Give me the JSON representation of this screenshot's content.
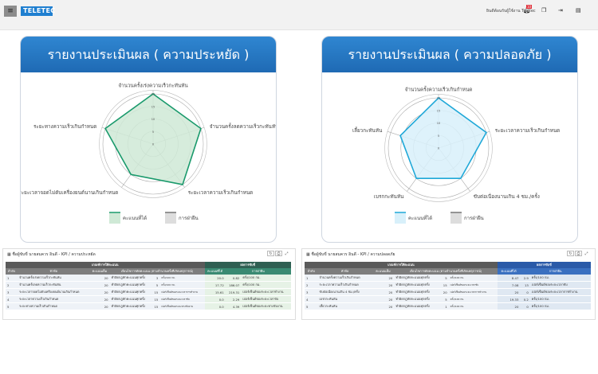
{
  "header": {
    "logo": "TELETEC",
    "welcome": "ยินดีต้อนรับผู้ใช้งาน Teletec",
    "notification_count": "10",
    "icons": [
      "menu-icon",
      "bell-icon",
      "copy-icon",
      "logout-icon",
      "settings-icon"
    ]
  },
  "colors": {
    "economy": "#1a9a6c",
    "economy_fill": "#cfe9d6",
    "safety": "#1fa8d8",
    "safety_fill": "#d8f0fa",
    "header_blue": "#2a7bc8"
  },
  "chart_data": [
    {
      "type": "radar",
      "title": "รายงานประเมินผล ( ความประหยัด )",
      "axes": [
        "จำนวนครั้งเร่งความเร็วกะทันหัน",
        "จำนวนครั้งลดความเร็วกะทันหัน",
        "ระยะเวลาความเร็วเกินกำหนด",
        "ระยะเวลาจอดไม่ดับเครื่องยนต์นานเกินกำหนด",
        "ระยะทางความเร็วเกินกำหนด"
      ],
      "ticks": [
        0,
        5,
        10,
        15,
        20
      ],
      "range": [
        0,
        20
      ],
      "series": [
        {
          "name": "คะแนนที่ได้",
          "values": [
            20,
            20,
            20,
            15,
            20
          ]
        },
        {
          "name": "การฝ่าฝืน",
          "values": []
        }
      ],
      "legend": "bottom"
    },
    {
      "type": "radar",
      "title": "รายงานประเมินผล ( ความปลอดภัย )",
      "axes": [
        "จำนวนครั้งความเร็วเกินกำหนด",
        "ระยะเวลาความเร็วเกินกำหนด",
        "ขับต่อเนื่องนานเกิน 4 ชม./ครั้ง",
        "เบรกกะทันหัน",
        "เลี้ยวกะทันหัน"
      ],
      "ticks": [
        0,
        5,
        10,
        15,
        20
      ],
      "range": [
        0,
        20
      ],
      "series": [
        {
          "name": "คะแนนที่ได้",
          "values": [
            20,
            20,
            15,
            15,
            16
          ]
        },
        {
          "name": "การฝ่าฝืน",
          "values": []
        }
      ],
      "legend": "bottom"
    }
  ],
  "tables": [
    {
      "title": "ชื่อผู้ขับขี่ นายสมควร อินดี - KPI / ความประหยัด",
      "group1": "เกณฑ์การให้คะแนน",
      "group2": "ผลการขับขี่",
      "cols": [
        "ลำดับ",
        "หัวข้อ",
        "คะแนนเต็ม",
        "เงื่อนไขการตัดคะแนน (ตามจำนวนครั้งที่เกิดเหตุการณ์)",
        "",
        "",
        "คะแนนที่ได้",
        "การฝ่าฝืน",
        ""
      ],
      "rows": [
        [
          "1",
          "จำนวนครั้งเร่งความเร็วกะทันหัน",
          "20",
          "ทำผิดกฎหักคะแนนทุกครั้ง",
          "3",
          "ครั้ง/100 กม.",
          "20.0",
          "0.82",
          "ครั้ง/100 กม."
        ],
        [
          "2",
          "จำนวนครั้งลดความเร็วกะทันหัน",
          "20",
          "ทำผิดกฎหักคะแนนทุกครั้ง",
          "5",
          "ครั้ง/100 กม.",
          "17.72",
          "186.07",
          "ครั้ง/100 กม."
        ],
        [
          "3",
          "ระยะเวลาจอดไม่ดับเครื่องยนต์นานเกินกำหนด",
          "20",
          "ทำผิดกฎหักคะแนนทุกครั้ง",
          "15",
          "เปอร์เซ็นต์ของระยะเวลาการทำงาน",
          "15.61",
          "219.31",
          "เปอร์เซ็นต์ของระยะเวลาทำงาน"
        ],
        [
          "4",
          "ระยะเวลาความเร็วเกินกำหนด",
          "20",
          "ทำผิดกฎหักคะแนนทุกครั้ง",
          "15",
          "เปอร์เซ็นต์ของระยะเวลาขับ",
          "0.0",
          "2.29",
          "เปอร์เซ็นต์ของระยะเวลาขับ"
        ],
        [
          "5",
          "ระยะทางความเร็วเกินกำหนด",
          "20",
          "ทำผิดกฎหักคะแนนทุกครั้ง",
          "15",
          "เปอร์เซ็นต์ของระยะทางขับงาน",
          "0.0",
          "4.39",
          "เปอร์เซ็นต์ของระยะทางขับงาน"
        ]
      ]
    },
    {
      "title": "ชื่อผู้ขับขี่ นายสมควร อินดี - KPI / ความปลอดภัย",
      "group1": "เกณฑ์การให้คะแนน",
      "group2": "ผลการขับขี่",
      "cols": [
        "ลำดับ",
        "หัวข้อ",
        "คะแนนเต็ม",
        "เงื่อนไขการตัดคะแนน (ตามจำนวนครั้งที่เกิดเหตุการณ์)",
        "",
        "",
        "คะแนนที่ได้",
        "การฝ่าฝืน",
        ""
      ],
      "rows": [
        [
          "1",
          "จำนวนครั้งความเร็วเกินกำหนด",
          "20",
          "ทำผิดกฎหักคะแนนทุกครั้ง",
          "5",
          "ครั้ง/100 กม.",
          "8.47",
          "2.9",
          "ครั้ง/100 กม."
        ],
        [
          "2",
          "ระยะเวลาความเร็วเกินกำหนด",
          "20",
          "ทำผิดกฎหักคะแนนทุกครั้ง",
          "15",
          "เปอร์เซ็นต์ของระยะเวลาขับ",
          "7.08",
          "13",
          "เปอร์เซ็นต์ของระยะเวลาขับ"
        ],
        [
          "3",
          "ขับต่อเนื่องนานเกิน 4 ชม./ครั้ง",
          "20",
          "ทำผิดกฎหักคะแนนทุกครั้ง",
          "20",
          "เปอร์เซ็นต์ของระยะเวลาการทำงาน",
          "20",
          "0",
          "เปอร์เซ็นต์ของระยะเวลาการทำงาน"
        ],
        [
          "4",
          "เบรกกะทันหัน",
          "20",
          "ทำผิดกฎหักคะแนนทุกครั้ง",
          "5",
          "ครั้ง/100 กม.",
          "19.33",
          "0.2",
          "ครั้ง/100 กม."
        ],
        [
          "5",
          "เลี้ยวกะทันหัน",
          "20",
          "ทำผิดกฎหักคะแนนทุกครั้ง",
          "1",
          "ครั้ง/100 กม.",
          "20",
          "0",
          "ครั้ง/100 กม."
        ]
      ]
    }
  ]
}
